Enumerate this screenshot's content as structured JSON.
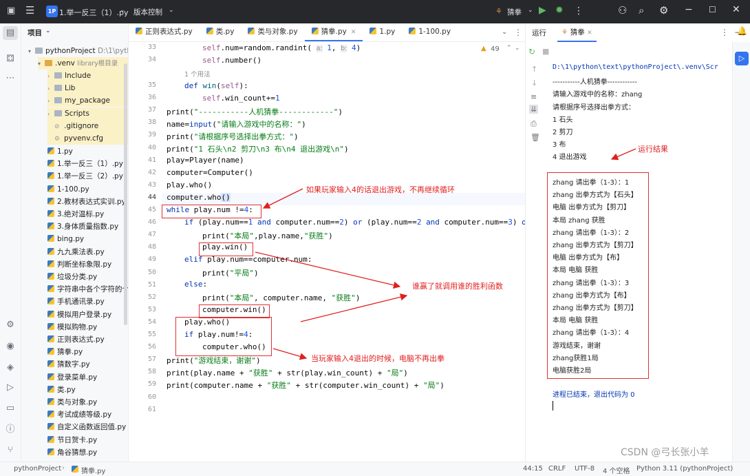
{
  "title_bar": {
    "project_badge": "1P",
    "project_name": "1.举一反三（1）.py",
    "vcs_label": "版本控制",
    "run_config": "猜拳"
  },
  "project_panel": {
    "title": "项目",
    "root": {
      "name": "pythonProject",
      "path": "D:\\1\\pyth"
    },
    "venv": {
      "name": ".venv",
      "note": "library根目录"
    },
    "venv_children": [
      "Include",
      "Lib",
      "my_package",
      "Scripts",
      ".gitignore",
      "pyvenv.cfg"
    ],
    "files": [
      "1.py",
      "1.举一反三（1）.py",
      "1.举一反三（2）.py",
      "1-100.py",
      "2.教材表达式实训.py",
      "3.绝对温标.py",
      "3.身体质量指数.py",
      "bing.py",
      "九九乘法表.py",
      "判断坐标象限.py",
      "垃圾分类.py",
      "字符串中各个字符的个数",
      "手机通讯录.py",
      "模拟用户登录.py",
      "模拟购物.py",
      "正则表达式.py",
      "猜拳.py",
      "猜数字.py",
      "登录菜单.py",
      "类.py",
      "类与对象.py",
      "考试成绩等级.py",
      "自定义函数返回值.py",
      "节日贺卡.py",
      "角谷猜想.py"
    ]
  },
  "editor": {
    "tabs": [
      "正则表达式.py",
      "类.py",
      "类与对象.py",
      "猜拳.py",
      "1.py",
      "1-100.py"
    ],
    "inspection_count": "49",
    "usage_hint": "1 个用法",
    "lines": [
      "33",
      "34",
      "",
      "35",
      "36",
      "37",
      "38",
      "39",
      "40",
      "41",
      "42",
      "43",
      "44",
      "45",
      "46",
      "47",
      "48",
      "49",
      "50",
      "51",
      "52",
      "53",
      "54",
      "55",
      "56",
      "57",
      "58",
      "59",
      "60",
      "61"
    ],
    "annotations": [
      "如果玩家输入4的话退出游戏，不再继续循环",
      "谁赢了就调用谁的胜利函数",
      "当玩家输入4退出的时候，电脑不再出拳",
      "运行结果"
    ]
  },
  "run_panel": {
    "title": "运行",
    "tab": "猜拳",
    "output_top": [
      "D:\\1\\python\\text\\pythonProject\\.venv\\Scr",
      "-----------人机猜拳------------",
      "请输入游戏中的名称：zhang",
      "请根据序号选择出拳方式：",
      "1 石头",
      "2 剪刀",
      "3 布",
      "4 退出游戏"
    ],
    "output_box": [
      "zhang 请出拳（1-3）：1",
      "zhang 出拳方式为【石头】",
      "电脑 出拳方式为【剪刀】",
      "本局 zhang 获胜",
      "zhang 请出拳（1-3）：2",
      "zhang 出拳方式为【剪刀】",
      "电脑 出拳方式为【布】",
      "本局 电脑 获胜",
      "zhang 请出拳（1-3）：3",
      "zhang 出拳方式为【布】",
      "zhang 出拳方式为【剪刀】",
      "本局 电脑 获胜",
      "zhang 请出拳（1-3）：4",
      "游戏结束，谢谢",
      "zhang获胜1局",
      "电脑获胜2局"
    ],
    "exit_msg": "进程已结束，退出代码为 0"
  },
  "status_bar": {
    "breadcrumb": [
      "pythonProject",
      "猜拳.py"
    ],
    "position": "44:15",
    "line_sep": "CRLF",
    "encoding": "UTF-8",
    "indent": "4 个空格",
    "interpreter": "Python 3.11 (pythonProject)",
    "watermark": "CSDN @弓长张小羊"
  }
}
